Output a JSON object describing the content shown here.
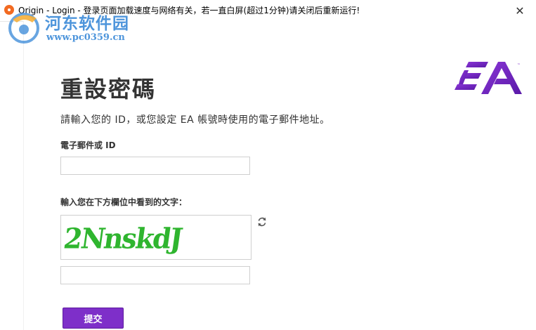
{
  "window": {
    "title": "Origin - Login - 登录页面加载速度与网络有关，若一直白屏(超过1分钟)请关闭后重新运行!",
    "close_glyph": "✕"
  },
  "watermark": {
    "line1": "河东软件园",
    "line2": "www.pc0359.cn",
    "color": "#3b8ad8"
  },
  "page": {
    "heading": "重設密碼",
    "instruction": "請輸入您的 ID，或您設定 EA 帳號時使用的電子郵件地址。",
    "email_label": "電子郵件或 ID",
    "email_value": "",
    "captcha_label": "輸入您在下方欄位中看到的文字：",
    "captcha_image_text": "2NnskdJ",
    "captcha_input_value": "",
    "submit_label": "提交"
  },
  "brand": {
    "logo": "ea-logo",
    "accent": "#7e2fc9",
    "captcha_color": "#2fb52f"
  }
}
